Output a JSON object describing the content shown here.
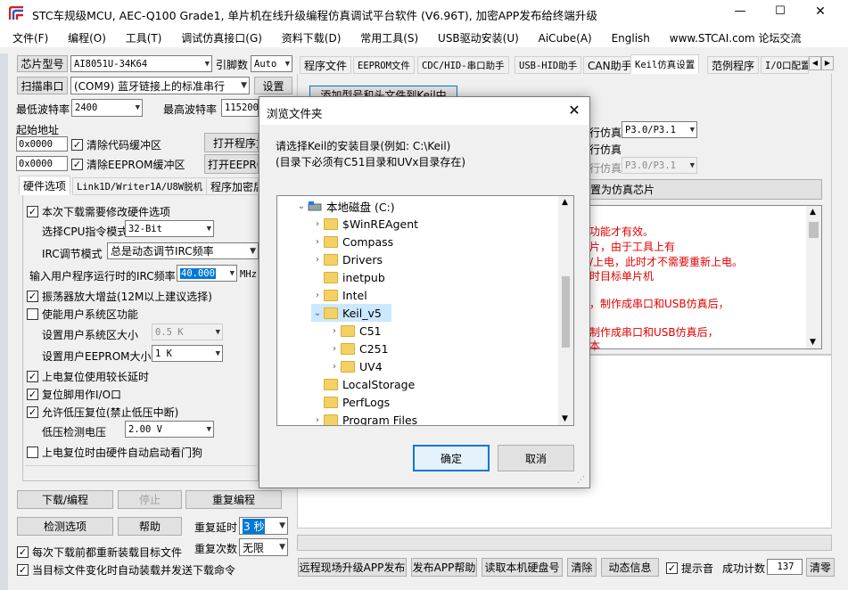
{
  "app": {
    "title": "STC车规级MCU, AEC-Q100 Grade1, 单片机在线升级编程仿真调试平台软件 (V6.96T), 加密APP发布给终端升级",
    "window_controls": [
      "—",
      "☐",
      "✕"
    ]
  },
  "menu": [
    "文件(F)",
    "编程(O)",
    "工具(T)",
    "调试仿真接口(G)",
    "资料下载(D)",
    "常用工具(S)",
    "USB驱动安装(U)",
    "AiCube(A)",
    "English",
    "www.STCAI.com 论坛交流"
  ],
  "left": {
    "chip_label": "芯片型号",
    "chip_value": "AI8051U-34K64",
    "pin_label": "引脚数",
    "pin_value": "Auto",
    "scan_label": "扫描串口",
    "port_value": "(COM9) 蓝牙链接上的标准串行",
    "settings_label": "设置",
    "min_baud_label": "最低波特率",
    "min_baud_value": "2400",
    "max_baud_label": "最高波特率",
    "max_baud_value": "115200",
    "start_addr_label": "起始地址",
    "addr1": "0x0000",
    "clear_code": "清除代码缓冲区",
    "open_prog": "打开程序文件",
    "addr2": "0x0000",
    "clear_eeprom": "清除EEPROM缓冲区",
    "open_eeprom": "打开EEPROM文件",
    "tabs": [
      "硬件选项",
      "Link1D/Writer1A/U8W脱机",
      "程序加密后"
    ],
    "hw": {
      "modify_hw": "本次下载需要修改硬件选项",
      "cpu_mode_label": "选择CPU指令模式",
      "cpu_mode_value": "32-Bit",
      "irc_mode_label": "IRC调节模式",
      "irc_mode_value": "总是动态调节IRC频率",
      "irc_freq_label": "输入用户程序运行时的IRC频率",
      "irc_freq_value": "40.000",
      "irc_unit": "MHz",
      "osc_gain": "振荡器放大增益(12M以上建议选择)",
      "user_sys_area": "使能用户系统区功能",
      "sys_size_label": "设置用户系统区大小",
      "sys_size_value": "0.5 K",
      "eeprom_size_label": "设置用户EEPROM大小",
      "eeprom_size_value": "1   K",
      "long_reset": "上电复位使用较长延时",
      "reset_io": "复位脚用作I/O口",
      "lvr": "允许低压复位(禁止低压中断)",
      "lvd_label": "低压检测电压",
      "lvd_value": "2.00 V",
      "watchdog": "上电复位时由硬件自动启动看门狗"
    },
    "download": "下载/编程",
    "stop": "停止",
    "redo": "重复编程",
    "check": "检测选项",
    "help": "帮助",
    "repeat_delay_label": "重复延时",
    "repeat_delay_value": "3 秒",
    "repeat_count_label": "重复次数",
    "repeat_count_value": "无限",
    "reload_each": "每次下载前都重新装载目标文件",
    "auto_send": "当目标文件变化时自动装载并发送下载命令"
  },
  "right": {
    "tabs": [
      "程序文件",
      "EEPROM文件",
      "CDC/HID-串口助手",
      "USB-HID助手",
      "CAN助手",
      "Keil仿真设置",
      "范例程序",
      "I/O口配置"
    ],
    "add_btn": "添加型号和头文件到Keil中",
    "sim1_suffix": "行仿真",
    "sim1_value": "P3.0/P3.1",
    "sim2_suffix": "行仿真",
    "sim3_suffix": "行仿真",
    "sim3_value": "P3.0/P3.1",
    "set_sim_chip": "置为仿真芯片",
    "info_lines": [
      "功能才有效。",
      "片，由于工具上有",
      "/上电，此时才不需要重新上电。",
      "时目标单片机",
      "，制作成串口和USB仿真后，",
      "制作成串口和USB仿真后，",
      "本"
    ]
  },
  "bottom": {
    "remote_upgrade": "远程现场升级APP发布",
    "publish_help": "发布APP帮助",
    "read_disk": "读取本机硬盘号",
    "clear": "清除",
    "anim": "动态信息",
    "beep": "提示音",
    "success_label": "成功计数",
    "success_value": "137",
    "clear_count": "清零"
  },
  "dialog": {
    "title": "浏览文件夹",
    "desc1": "请选择Keil的安装目录(例如: C:\\Keil)",
    "desc2": "(目录下必须有C51目录和UVx目录存在)",
    "tree": [
      {
        "label": "本地磁盘 (C:)",
        "level": 0,
        "state": "expanded",
        "kind": "drive"
      },
      {
        "label": "$WinREAgent",
        "level": 1,
        "state": "collapsed",
        "kind": "folder"
      },
      {
        "label": "Compass",
        "level": 1,
        "state": "collapsed",
        "kind": "folder"
      },
      {
        "label": "Drivers",
        "level": 1,
        "state": "collapsed",
        "kind": "folder"
      },
      {
        "label": "inetpub",
        "level": 1,
        "state": "none",
        "kind": "folder"
      },
      {
        "label": "Intel",
        "level": 1,
        "state": "collapsed",
        "kind": "folder"
      },
      {
        "label": "Keil_v5",
        "level": 1,
        "state": "expanded",
        "kind": "folder",
        "selected": true
      },
      {
        "label": "C51",
        "level": 2,
        "state": "collapsed",
        "kind": "folder"
      },
      {
        "label": "C251",
        "level": 2,
        "state": "collapsed",
        "kind": "folder"
      },
      {
        "label": "UV4",
        "level": 2,
        "state": "collapsed",
        "kind": "folder"
      },
      {
        "label": "LocalStorage",
        "level": 1,
        "state": "none",
        "kind": "folder"
      },
      {
        "label": "PerfLogs",
        "level": 1,
        "state": "none",
        "kind": "folder"
      },
      {
        "label": "Program Files",
        "level": 1,
        "state": "collapsed",
        "kind": "folder"
      }
    ],
    "ok": "确定",
    "cancel": "取消"
  },
  "colors": {
    "accent": "#0078d7",
    "highlight": "#cce8ff",
    "red_text": "#e00000",
    "folder": "#f4d166"
  }
}
